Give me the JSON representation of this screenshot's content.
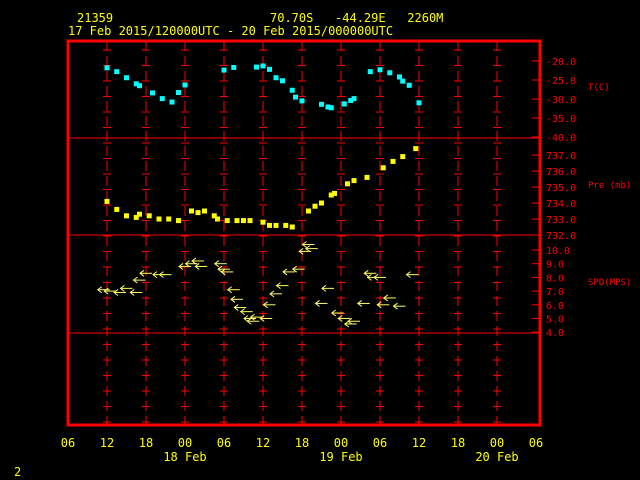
{
  "header": {
    "station_id": "21359",
    "location": "70.70S   -44.29E   2260M",
    "time_range": "17 Feb 2015/120000UTC - 20 Feb 2015/000000UTC"
  },
  "page_number": "2",
  "colors": {
    "frame": "#ff0000",
    "text_header": "#ffff00",
    "axis_labels": "#ff0000",
    "temperature": "#00ffff",
    "pressure": "#ffff00",
    "wind": "#ffff66"
  },
  "chart_data": [
    {
      "type": "scatter",
      "panel": "temperature",
      "ylabel": "T(C)",
      "yticks": [
        -20.0,
        -25.0,
        -30.0,
        -35.0,
        -40.0
      ],
      "ylim": [
        -40,
        -18
      ],
      "x_hours_from_start": [
        0,
        1.5,
        3,
        4.5,
        5,
        7,
        8.5,
        10,
        11,
        12,
        18,
        19.5,
        23,
        24,
        25,
        26,
        27,
        28.5,
        29,
        30,
        33,
        34,
        34.5,
        36.5,
        37.5,
        38,
        40.5,
        42,
        43.5,
        45,
        45.5,
        46.5,
        48
      ],
      "values": [
        -21.8,
        -22.8,
        -24.4,
        -26.0,
        -26.5,
        -28.4,
        -29.9,
        -30.8,
        -28.3,
        -26.3,
        -22.4,
        -21.7,
        -21.6,
        -21.3,
        -22.2,
        -24.4,
        -25.2,
        -27.7,
        -29.5,
        -30.5,
        -31.4,
        -32.1,
        -32.3,
        -31.3,
        -30.4,
        -29.9,
        -22.8,
        -22.3,
        -23.1,
        -24.2,
        -25.3,
        -26.4,
        -31.0
      ]
    },
    {
      "type": "scatter",
      "panel": "pressure",
      "ylabel": "Pre (mb)",
      "yticks": [
        737.0,
        736.0,
        735.0,
        734.0,
        733.0,
        732.0
      ],
      "ylim": [
        732,
        738
      ],
      "x_hours_from_start": [
        0,
        1.5,
        3,
        4.5,
        5,
        6.5,
        8,
        9.5,
        11,
        13,
        14,
        15,
        16.5,
        17,
        18.5,
        20,
        21,
        22,
        24,
        25,
        26,
        27.5,
        28.5,
        31,
        32,
        33,
        34.5,
        35,
        37,
        38,
        40,
        42.5,
        44,
        45.5,
        47.5
      ],
      "values": [
        734.1,
        733.6,
        733.2,
        733.1,
        733.3,
        733.2,
        733.0,
        733.0,
        732.9,
        733.5,
        733.4,
        733.5,
        733.2,
        733.0,
        732.9,
        732.9,
        732.9,
        732.9,
        732.8,
        732.6,
        732.6,
        732.6,
        732.5,
        733.5,
        733.8,
        734.0,
        734.5,
        734.6,
        735.2,
        735.4,
        735.6,
        736.2,
        736.6,
        736.9,
        737.4
      ]
    },
    {
      "type": "scatter",
      "panel": "wind",
      "ylabel": "SPD(MPS)",
      "yticks": [
        10.0,
        9.0,
        8.0,
        7.0,
        6.0,
        5.0,
        4.0
      ],
      "ylim": [
        4,
        11
      ],
      "x_hours_from_start": [
        -0.5,
        0.5,
        2,
        3,
        4.5,
        5,
        6,
        8,
        9,
        12,
        13,
        14,
        14.5,
        17.5,
        18,
        18.5,
        19.5,
        20,
        20.5,
        21.5,
        22,
        22.5,
        23,
        24.5,
        25,
        26,
        27,
        28,
        29.5,
        30.5,
        31,
        31.5,
        33,
        34,
        35.5,
        36.5,
        37.5,
        38,
        39.5,
        40.5,
        41,
        42,
        42.5,
        43.5,
        45,
        47
      ],
      "values": [
        7.1,
        7.0,
        6.9,
        7.2,
        6.9,
        7.8,
        8.3,
        8.2,
        8.2,
        8.8,
        9.0,
        9.2,
        8.8,
        9.0,
        8.6,
        8.4,
        7.1,
        6.4,
        5.8,
        5.5,
        5.0,
        4.8,
        5.1,
        5.0,
        6.0,
        6.8,
        7.4,
        8.4,
        8.6,
        9.9,
        10.4,
        10.1,
        6.1,
        7.2,
        5.4,
        5.0,
        4.6,
        4.8,
        6.1,
        8.3,
        8.0,
        8.0,
        6.0,
        6.5,
        5.9,
        8.2
      ],
      "marker": "wind-arrow"
    }
  ],
  "x_axis": {
    "tick_labels": [
      "06",
      "12",
      "18",
      "00",
      "06",
      "12",
      "18",
      "00",
      "06",
      "12",
      "18",
      "00",
      "06"
    ],
    "date_labels": [
      "18 Feb",
      "19 Feb",
      "20 Feb"
    ],
    "start_tick_time": "17 Feb 2015 06 UTC",
    "tick_interval_hours": 6
  }
}
